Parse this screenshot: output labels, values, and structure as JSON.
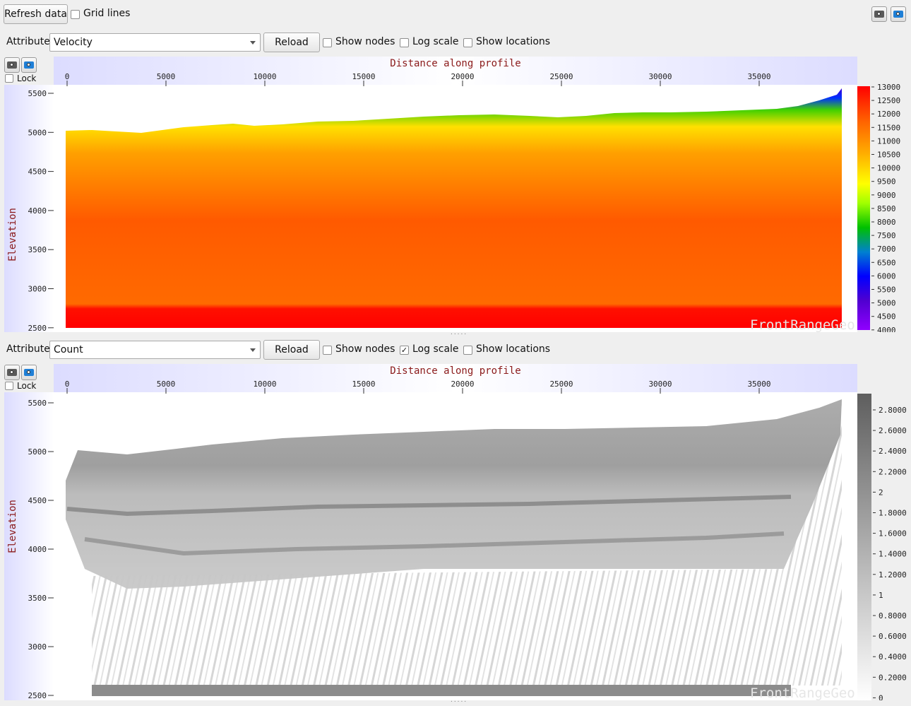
{
  "toolbar": {
    "refresh_label": "Refresh data",
    "grid_lines_label": "Grid lines",
    "grid_lines_checked": false
  },
  "watermark": "FrontRangeGeo",
  "panels": [
    {
      "attribute_label": "Attribute",
      "attribute_value": "Velocity",
      "reload_label": "Reload",
      "show_nodes_label": "Show nodes",
      "show_nodes_checked": false,
      "log_scale_label": "Log scale",
      "log_scale_checked": false,
      "show_locations_label": "Show locations",
      "show_locations_checked": false,
      "lock_label": "Lock",
      "lock_checked": false,
      "x_title": "Distance along profile",
      "y_title": "Elevation",
      "x_ticks": [
        "0",
        "5000",
        "10000",
        "15000",
        "20000",
        "25000",
        "30000",
        "35000"
      ],
      "y_ticks": [
        "5500",
        "5000",
        "4500",
        "4000",
        "3500",
        "3000",
        "2500"
      ],
      "colorbar_ticks": [
        "13000",
        "12500",
        "12000",
        "11500",
        "11000",
        "10500",
        "10000",
        "9500",
        "9000",
        "8500",
        "8000",
        "7500",
        "7000",
        "6500",
        "6000",
        "5500",
        "5000",
        "4500",
        "4000"
      ],
      "colormap": [
        "#7a00ff",
        "#4000ff",
        "#0000ff",
        "#0080ff",
        "#00c000",
        "#80ff00",
        "#ffff00",
        "#ffd000",
        "#ffa000",
        "#ff7000",
        "#ff3000",
        "#ff0000"
      ]
    },
    {
      "attribute_label": "Attribute",
      "attribute_value": "Count",
      "reload_label": "Reload",
      "show_nodes_label": "Show nodes",
      "show_nodes_checked": false,
      "log_scale_label": "Log scale",
      "log_scale_checked": true,
      "show_locations_label": "Show locations",
      "show_locations_checked": false,
      "lock_label": "Lock",
      "lock_checked": false,
      "x_title": "Distance along profile",
      "y_title": "Elevation",
      "x_ticks": [
        "0",
        "5000",
        "10000",
        "15000",
        "20000",
        "25000",
        "30000",
        "35000"
      ],
      "y_ticks": [
        "5500",
        "5000",
        "4500",
        "4000",
        "3500",
        "3000",
        "2500"
      ],
      "colorbar_ticks": [
        "2.8000",
        "2.6000",
        "2.4000",
        "2.2000",
        "2",
        "1.8000",
        "1.6000",
        "1.4000",
        "1.2000",
        "1",
        "0.8000",
        "0.6000",
        "0.4000",
        "0.2000",
        "0"
      ],
      "colormap": [
        "#ffffff",
        "#d0d0d0",
        "#a8a8a8",
        "#808080",
        "#606060"
      ]
    }
  ]
}
